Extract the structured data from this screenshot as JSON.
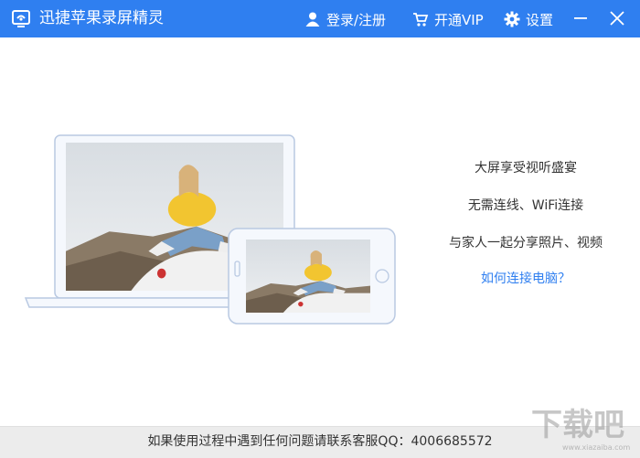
{
  "app": {
    "title": "迅捷苹果录屏精灵",
    "brand_color": "#2f7ff0"
  },
  "titlebar": {
    "login_label": "登录/注册",
    "vip_label": "开通VIP",
    "settings_label": "设置",
    "icons": [
      "app-logo-icon",
      "user-icon",
      "cart-icon",
      "gear-icon",
      "minimize-icon",
      "close-icon"
    ]
  },
  "features": {
    "line1": "大屏享受视听盛宴",
    "line2": "无需连线、WiFi连接",
    "line3": "与家人一起分享照片、视频",
    "help_link": "如何连接电脑？"
  },
  "footer": {
    "support_text": "如果使用过程中遇到任何问题请联系客服QQ：4006685572"
  },
  "watermark": {
    "text": "下载吧",
    "url_text": "www.xiazaiba.com"
  }
}
